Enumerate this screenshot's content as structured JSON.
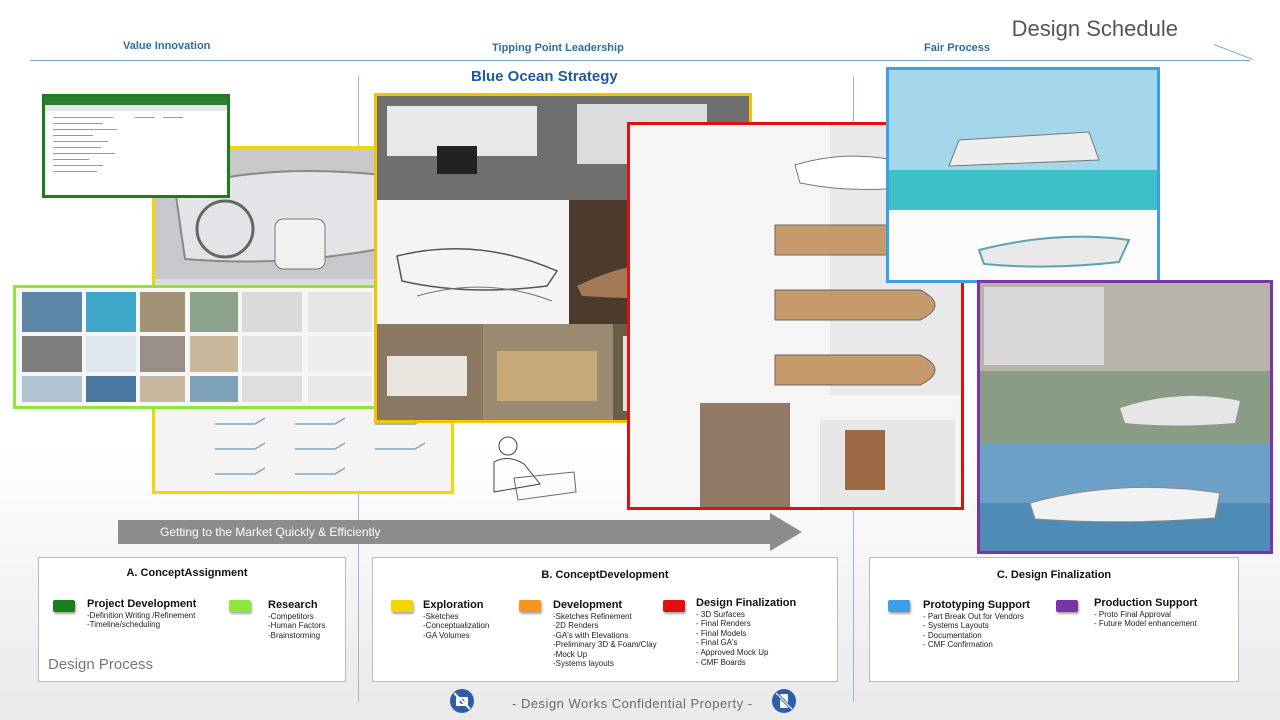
{
  "header": {
    "title": "Design Schedule"
  },
  "phases": [
    "Value Innovation",
    "Tipping Point Leadership",
    "Fair Process"
  ],
  "strategy_title": "Blue Ocean Strategy",
  "timeline_arrow": "Getting to the Market Quickly & Efficiently",
  "footer": "- Design Works Confidential Property -",
  "design_process_label": "Design Process",
  "colors": {
    "green": "#1a7f1a",
    "lime": "#8ee63c",
    "yellow": "#f2d600",
    "orange": "#f7941d",
    "red": "#e01010",
    "blue": "#3aa0e8",
    "purple": "#7a34a8"
  },
  "sections": {
    "a": {
      "title": "A. ConceptAssignment",
      "items": [
        {
          "title": "Project Development",
          "lines": [
            "-Definition Writing /Refinement",
            "-Timeline/scheduling"
          ]
        },
        {
          "title": "Research",
          "lines": [
            "-Competitors",
            "-Human  Factors",
            "-Brainstorming"
          ]
        }
      ]
    },
    "b": {
      "title": "B. ConceptDevelopment",
      "items": [
        {
          "title": "Exploration",
          "lines": [
            "-Sketches",
            "-Conceptualization",
            "-GA Volumes"
          ]
        },
        {
          "title": "Development",
          "lines": [
            "-Sketches  Refinement",
            "-2D Renders",
            "-GA's with  Elevations",
            "-Preliminary  3D  & Foam/Clay",
            "-Mock Up",
            "-Systems  layouts"
          ]
        },
        {
          "title": "Design Finalization",
          "lines": [
            "- 3D  Surfaces",
            "- Final Renders",
            "- Final Models",
            "- Final GA's",
            "- Approved  Mock  Up",
            "- CMF Boards"
          ]
        }
      ]
    },
    "c": {
      "title": "C. Design Finalization",
      "items": [
        {
          "title": "Prototyping Support",
          "lines": [
            "- Part Break Out for Vendors",
            "-  Systems  Layouts",
            "- Documentation",
            "- CMF Confirmation"
          ]
        },
        {
          "title": "Production Support",
          "lines": [
            "- Proto Final Approval",
            "- Future Model enhancement"
          ]
        }
      ]
    }
  }
}
